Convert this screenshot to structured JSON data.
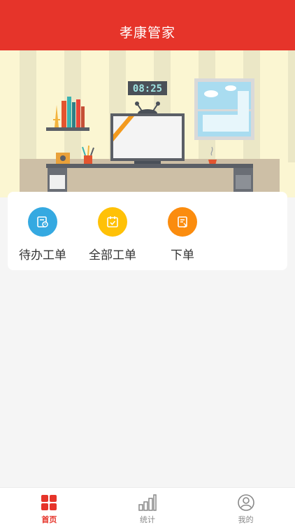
{
  "header": {
    "title": "孝康管家"
  },
  "banner": {
    "clock_text": "08:25",
    "icon": "office-desk-illustration"
  },
  "actions": [
    {
      "label": "待办工单",
      "icon": "pending-order-icon",
      "color": "#35a9e1"
    },
    {
      "label": "全部工单",
      "icon": "all-orders-icon",
      "color": "#ffc107"
    },
    {
      "label": "下单",
      "icon": "place-order-icon",
      "color": "#fb8c0e"
    }
  ],
  "tabbar": {
    "active_color": "#e6342a",
    "items": [
      {
        "label": "首页",
        "icon": "home-grid-icon",
        "active": true
      },
      {
        "label": "统计",
        "icon": "bar-chart-icon",
        "active": false
      },
      {
        "label": "我的",
        "icon": "user-profile-icon",
        "active": false
      }
    ]
  }
}
